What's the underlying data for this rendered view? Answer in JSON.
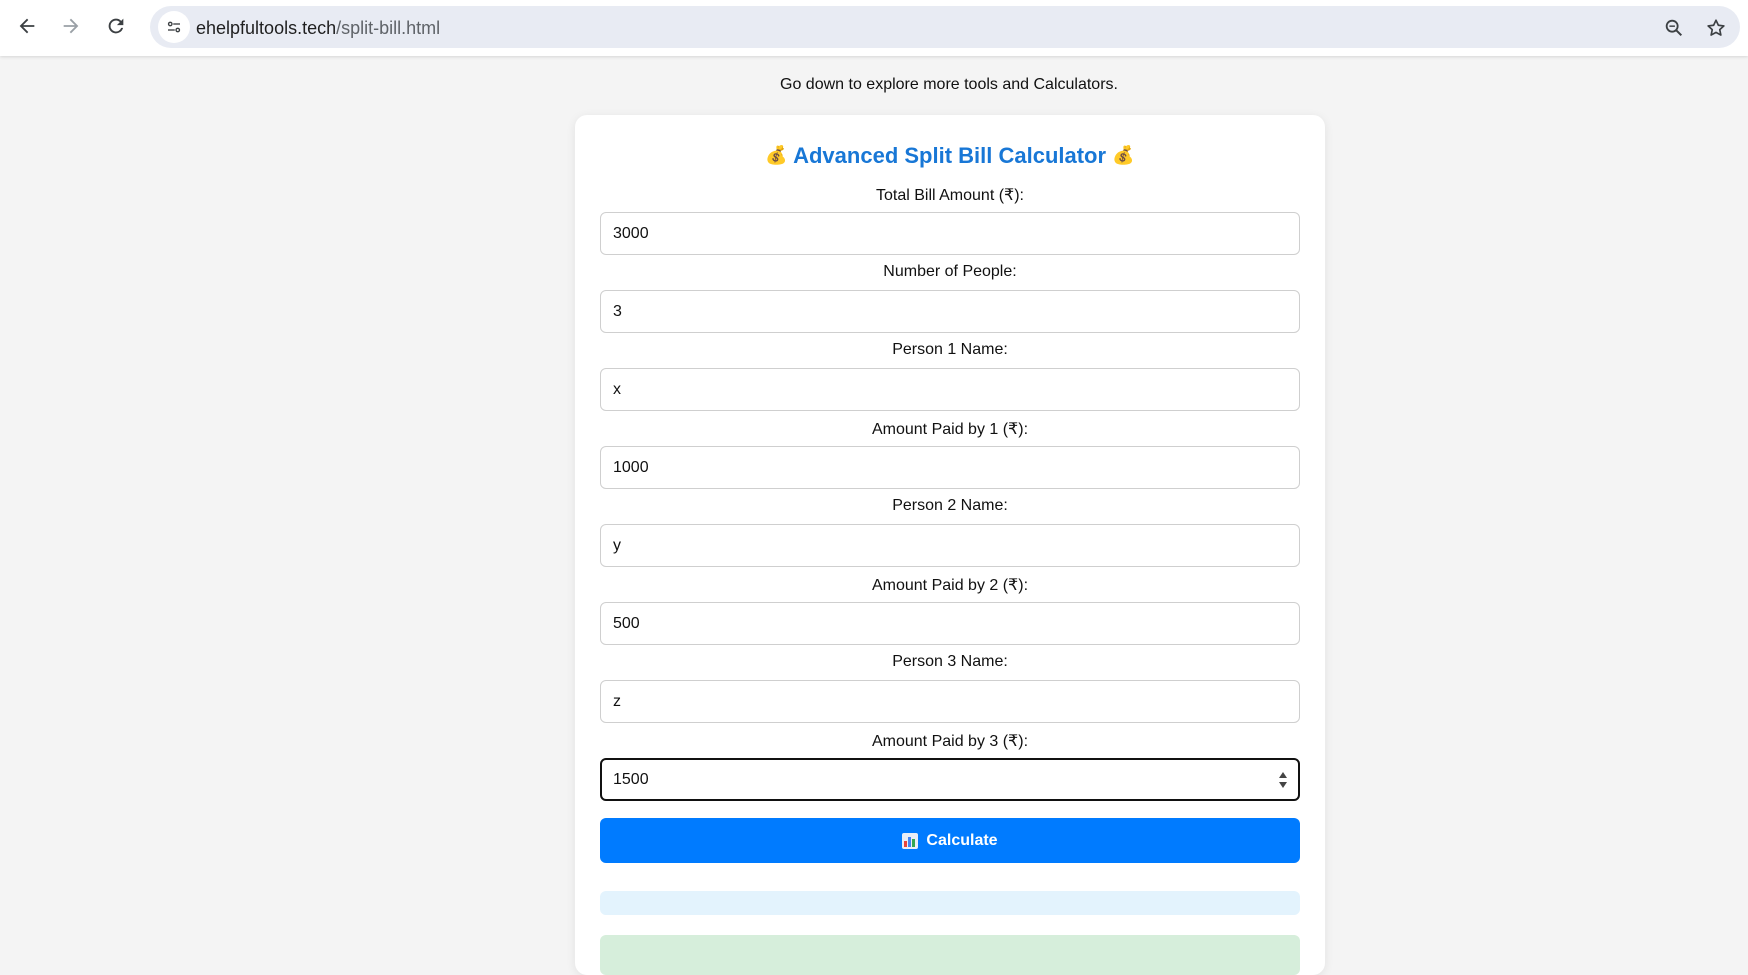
{
  "browser": {
    "url_host": "ehelpfultools.tech",
    "url_path": "/split-bill.html",
    "back_icon": "arrow-left-icon",
    "forward_icon": "arrow-right-icon",
    "reload_icon": "reload-icon",
    "site_info_icon": "tune-icon",
    "zoom_icon": "zoom-icon",
    "bookmark_icon": "star-icon"
  },
  "page": {
    "notice": "Go down to explore more tools and Calculators."
  },
  "calculator": {
    "title": "Advanced Split Bill Calculator",
    "title_emoji": "💰",
    "title_color": "#1877d6",
    "fields": [
      {
        "label": "Total Bill Amount (₹):",
        "value": "3000"
      },
      {
        "label": "Number of People:",
        "value": "3"
      },
      {
        "label": "Person 1 Name:",
        "value": "x"
      },
      {
        "label": "Amount Paid by 1 (₹):",
        "value": "1000"
      },
      {
        "label": "Person 2 Name:",
        "value": "y"
      },
      {
        "label": "Amount Paid by 2 (₹):",
        "value": "500"
      },
      {
        "label": "Person 3 Name:",
        "value": "z"
      },
      {
        "label": "Amount Paid by 3 (₹):",
        "value": "1500"
      }
    ],
    "calculate_label": "Calculate",
    "calculate_icon": "bar-chart-icon",
    "button_color": "#007bff"
  }
}
